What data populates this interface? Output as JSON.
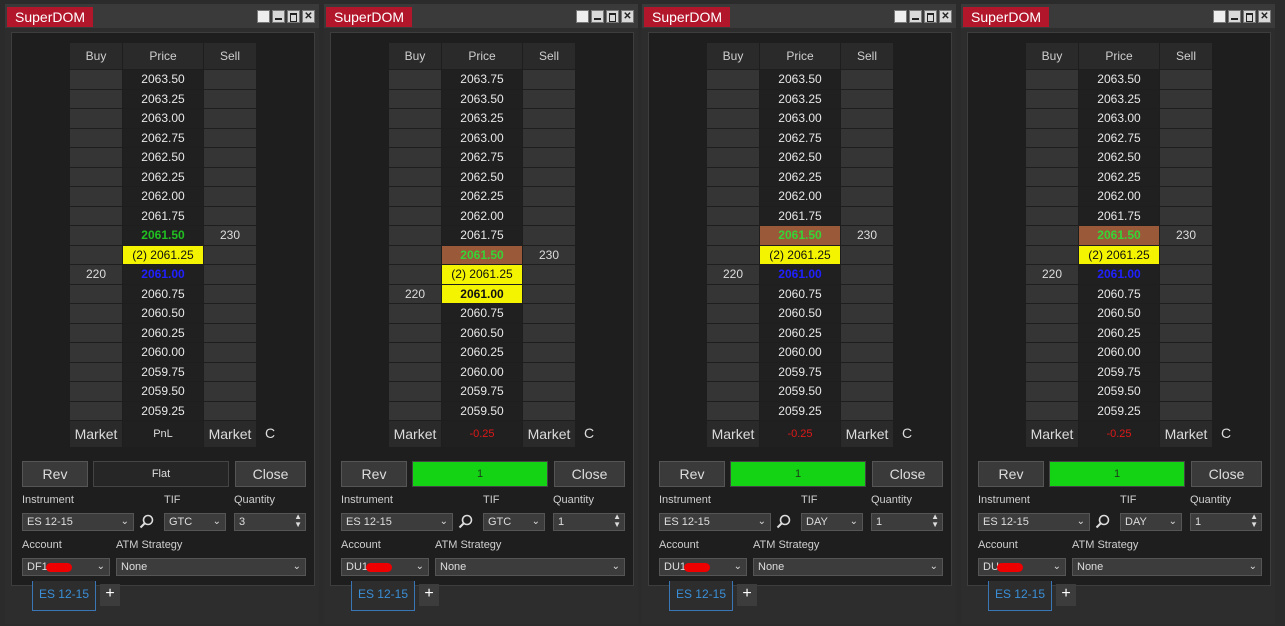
{
  "app_title": "SuperDOM",
  "header": {
    "buy": "Buy",
    "price": "Price",
    "sell": "Sell"
  },
  "footer": {
    "market": "Market",
    "c": "C",
    "pnl_label": "PnL",
    "neg": "-0.25"
  },
  "buttons": {
    "rev": "Rev",
    "close": "Close",
    "flat": "Flat",
    "one": "1"
  },
  "labels": {
    "instrument": "Instrument",
    "tif": "TIF",
    "quantity": "Quantity",
    "account": "Account",
    "atm": "ATM Strategy"
  },
  "windows": [
    {
      "rows": [
        {
          "price": "2063.50",
          "buy": "",
          "sell": "",
          "style": ""
        },
        {
          "price": "2063.25",
          "buy": "",
          "sell": "",
          "style": ""
        },
        {
          "price": "2063.00",
          "buy": "",
          "sell": "",
          "style": ""
        },
        {
          "price": "2062.75",
          "buy": "",
          "sell": "",
          "style": ""
        },
        {
          "price": "2062.50",
          "buy": "",
          "sell": "",
          "style": ""
        },
        {
          "price": "2062.25",
          "buy": "",
          "sell": "",
          "style": ""
        },
        {
          "price": "2062.00",
          "buy": "",
          "sell": "",
          "style": ""
        },
        {
          "price": "2061.75",
          "buy": "",
          "sell": "",
          "style": ""
        },
        {
          "price": "2061.50",
          "buy": "",
          "sell": "230",
          "style": "green"
        },
        {
          "price": "(2) 2061.25",
          "buy": "",
          "sell": "",
          "style": "yellow"
        },
        {
          "price": "2061.00",
          "buy": "220",
          "sell": "",
          "style": "blue"
        },
        {
          "price": "2060.75",
          "buy": "",
          "sell": "",
          "style": ""
        },
        {
          "price": "2060.50",
          "buy": "",
          "sell": "",
          "style": ""
        },
        {
          "price": "2060.25",
          "buy": "",
          "sell": "",
          "style": ""
        },
        {
          "price": "2060.00",
          "buy": "",
          "sell": "",
          "style": ""
        },
        {
          "price": "2059.75",
          "buy": "",
          "sell": "",
          "style": ""
        },
        {
          "price": "2059.50",
          "buy": "",
          "sell": "",
          "style": ""
        },
        {
          "price": "2059.25",
          "buy": "",
          "sell": "",
          "style": ""
        }
      ],
      "footer_mid": "PnL",
      "footer_mid_red": false,
      "position": "Flat",
      "position_green": false,
      "instrument": "ES 12-15",
      "tif": "GTC",
      "quantity": "3",
      "account": "DF1",
      "atm": "None",
      "bottom_tab": "ES 12-15"
    },
    {
      "rows": [
        {
          "price": "2063.75",
          "buy": "",
          "sell": "",
          "style": ""
        },
        {
          "price": "2063.50",
          "buy": "",
          "sell": "",
          "style": ""
        },
        {
          "price": "2063.25",
          "buy": "",
          "sell": "",
          "style": ""
        },
        {
          "price": "2063.00",
          "buy": "",
          "sell": "",
          "style": ""
        },
        {
          "price": "2062.75",
          "buy": "",
          "sell": "",
          "style": ""
        },
        {
          "price": "2062.50",
          "buy": "",
          "sell": "",
          "style": ""
        },
        {
          "price": "2062.25",
          "buy": "",
          "sell": "",
          "style": ""
        },
        {
          "price": "2062.00",
          "buy": "",
          "sell": "",
          "style": ""
        },
        {
          "price": "2061.75",
          "buy": "",
          "sell": "",
          "style": ""
        },
        {
          "price": "2061.50",
          "buy": "",
          "sell": "230",
          "style": "brown"
        },
        {
          "price": "(2) 2061.25",
          "buy": "",
          "sell": "",
          "style": "yellow"
        },
        {
          "price": "2061.00",
          "buy": "220",
          "sell": "",
          "style": "blue-yellow"
        },
        {
          "price": "2060.75",
          "buy": "",
          "sell": "",
          "style": ""
        },
        {
          "price": "2060.50",
          "buy": "",
          "sell": "",
          "style": ""
        },
        {
          "price": "2060.25",
          "buy": "",
          "sell": "",
          "style": ""
        },
        {
          "price": "2060.00",
          "buy": "",
          "sell": "",
          "style": ""
        },
        {
          "price": "2059.75",
          "buy": "",
          "sell": "",
          "style": ""
        },
        {
          "price": "2059.50",
          "buy": "",
          "sell": "",
          "style": ""
        }
      ],
      "footer_mid": "-0.25",
      "footer_mid_red": true,
      "position": "1",
      "position_green": true,
      "instrument": "ES 12-15",
      "tif": "GTC",
      "quantity": "1",
      "account": "DU1",
      "atm": "None",
      "bottom_tab": "ES 12-15"
    },
    {
      "rows": [
        {
          "price": "2063.50",
          "buy": "",
          "sell": "",
          "style": ""
        },
        {
          "price": "2063.25",
          "buy": "",
          "sell": "",
          "style": ""
        },
        {
          "price": "2063.00",
          "buy": "",
          "sell": "",
          "style": ""
        },
        {
          "price": "2062.75",
          "buy": "",
          "sell": "",
          "style": ""
        },
        {
          "price": "2062.50",
          "buy": "",
          "sell": "",
          "style": ""
        },
        {
          "price": "2062.25",
          "buy": "",
          "sell": "",
          "style": ""
        },
        {
          "price": "2062.00",
          "buy": "",
          "sell": "",
          "style": ""
        },
        {
          "price": "2061.75",
          "buy": "",
          "sell": "",
          "style": ""
        },
        {
          "price": "2061.50",
          "buy": "",
          "sell": "230",
          "style": "brown"
        },
        {
          "price": "(2) 2061.25",
          "buy": "",
          "sell": "",
          "style": "yellow"
        },
        {
          "price": "2061.00",
          "buy": "220",
          "sell": "",
          "style": "blue"
        },
        {
          "price": "2060.75",
          "buy": "",
          "sell": "",
          "style": ""
        },
        {
          "price": "2060.50",
          "buy": "",
          "sell": "",
          "style": ""
        },
        {
          "price": "2060.25",
          "buy": "",
          "sell": "",
          "style": ""
        },
        {
          "price": "2060.00",
          "buy": "",
          "sell": "",
          "style": ""
        },
        {
          "price": "2059.75",
          "buy": "",
          "sell": "",
          "style": ""
        },
        {
          "price": "2059.50",
          "buy": "",
          "sell": "",
          "style": ""
        },
        {
          "price": "2059.25",
          "buy": "",
          "sell": "",
          "style": ""
        }
      ],
      "footer_mid": "-0.25",
      "footer_mid_red": true,
      "position": "1",
      "position_green": true,
      "instrument": "ES 12-15",
      "tif": "DAY",
      "quantity": "1",
      "account": "DU1",
      "atm": "None",
      "bottom_tab": "ES 12-15"
    },
    {
      "rows": [
        {
          "price": "2063.50",
          "buy": "",
          "sell": "",
          "style": ""
        },
        {
          "price": "2063.25",
          "buy": "",
          "sell": "",
          "style": ""
        },
        {
          "price": "2063.00",
          "buy": "",
          "sell": "",
          "style": ""
        },
        {
          "price": "2062.75",
          "buy": "",
          "sell": "",
          "style": ""
        },
        {
          "price": "2062.50",
          "buy": "",
          "sell": "",
          "style": ""
        },
        {
          "price": "2062.25",
          "buy": "",
          "sell": "",
          "style": ""
        },
        {
          "price": "2062.00",
          "buy": "",
          "sell": "",
          "style": ""
        },
        {
          "price": "2061.75",
          "buy": "",
          "sell": "",
          "style": ""
        },
        {
          "price": "2061.50",
          "buy": "",
          "sell": "230",
          "style": "brown"
        },
        {
          "price": "(2) 2061.25",
          "buy": "",
          "sell": "",
          "style": "yellow"
        },
        {
          "price": "2061.00",
          "buy": "220",
          "sell": "",
          "style": "blue"
        },
        {
          "price": "2060.75",
          "buy": "",
          "sell": "",
          "style": ""
        },
        {
          "price": "2060.50",
          "buy": "",
          "sell": "",
          "style": ""
        },
        {
          "price": "2060.25",
          "buy": "",
          "sell": "",
          "style": ""
        },
        {
          "price": "2060.00",
          "buy": "",
          "sell": "",
          "style": ""
        },
        {
          "price": "2059.75",
          "buy": "",
          "sell": "",
          "style": ""
        },
        {
          "price": "2059.50",
          "buy": "",
          "sell": "",
          "style": ""
        },
        {
          "price": "2059.25",
          "buy": "",
          "sell": "",
          "style": ""
        }
      ],
      "footer_mid": "-0.25",
      "footer_mid_red": true,
      "position": "1",
      "position_green": true,
      "instrument": "ES 12-15",
      "tif": "DAY",
      "quantity": "1",
      "account": "DU",
      "atm": "None",
      "bottom_tab": "ES 12-15"
    }
  ]
}
